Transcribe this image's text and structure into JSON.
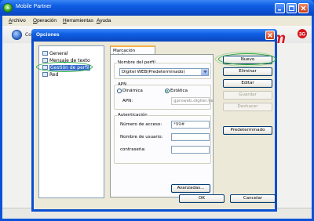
{
  "window": {
    "title": "Mobile Partner"
  },
  "menu": [
    {
      "label": "Archivo",
      "mnemonic": "A",
      "rest": "rchivo"
    },
    {
      "label": "Operación",
      "mnemonic": "O",
      "rest": "peración"
    },
    {
      "label": "Herramientas",
      "mnemonic": "H",
      "rest": "erramientas"
    },
    {
      "label": "Ayuda",
      "mnemonic": "A",
      "rest": "yuda"
    }
  ],
  "toolbar": {
    "connect_text": "Cone"
  },
  "dialog": {
    "title": "Opciones",
    "tree": [
      {
        "label": "General"
      },
      {
        "label": "Mensaje de texto"
      },
      {
        "label": "Gestión de perfil"
      },
      {
        "label": "Red"
      }
    ],
    "tab": "Marcación telefónica",
    "profile_group": {
      "title": "Nombre del perfil",
      "selected": "Digitel WEB(Predeterminado)"
    },
    "apn_group": {
      "title": "APN",
      "dynamic": "Dinámica",
      "static": "Estática",
      "apn_label": "APN:",
      "apn_value": "gprsweb.digitel.ve"
    },
    "auth_group": {
      "title": "Autenticación",
      "access_label": "Número de acceso:",
      "access_value": "*99#",
      "user_label": "Nombre de usuario:",
      "user_value": "",
      "password_label": "contraseña:",
      "password_value": ""
    },
    "advanced_button": "Avanzadas...",
    "side_buttons": {
      "new": "Nuevo",
      "delete": "Eliminar",
      "edit": "Editar",
      "save": "Guardar",
      "undo": "Deshacer",
      "default": "Predeterminado"
    },
    "ok": "OK",
    "cancel": "Cancelar"
  },
  "colors": {
    "xp_blue": "#0a53d8",
    "highlight": "#316ac5",
    "annotation_green": "#23a83a"
  }
}
